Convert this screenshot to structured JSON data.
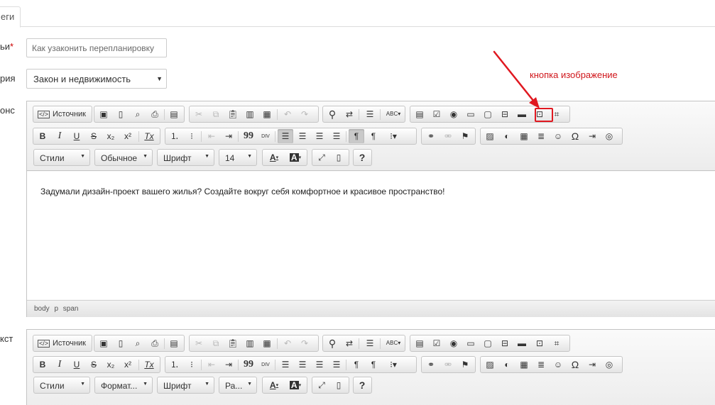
{
  "tab": {
    "label": "еги"
  },
  "fields": {
    "title_label": "ьи",
    "title_required": "*",
    "title_placeholder": "Как узаконить перепланировку",
    "category_label": "рия",
    "category_value": "Закон и недвижимость",
    "anons_label": "онс",
    "text_label": "кст"
  },
  "editor1": {
    "source_label": "Источник",
    "styles": "Стили",
    "format": "Обычное",
    "font": "Шрифт",
    "size": "14",
    "content": "Задумали дизайн-проект вашего жилья? Создайте вокруг себя комфортное и красивое пространство!",
    "path": "body p span"
  },
  "editor2": {
    "source_label": "Источник",
    "styles": "Стили",
    "format": "Формат...",
    "font": "Шрифт",
    "size": "Ра..."
  },
  "toolbar_glyphs": {
    "abc": "ABC",
    "div": "DIV",
    "quote": "99",
    "omega": "Ω",
    "help": "?",
    "bold": "B",
    "italic": "I",
    "underline": "U",
    "strike": "S",
    "sub": "x₂",
    "sup": "x²",
    "remove_format": "Tx",
    "text_color": "A",
    "bg_color": "A"
  },
  "annotation": {
    "text": "кнопка изображение"
  },
  "colors": {
    "annotation": "#d0161b",
    "border": "#c4c4c4",
    "toolbar_bg": "#ececec"
  }
}
